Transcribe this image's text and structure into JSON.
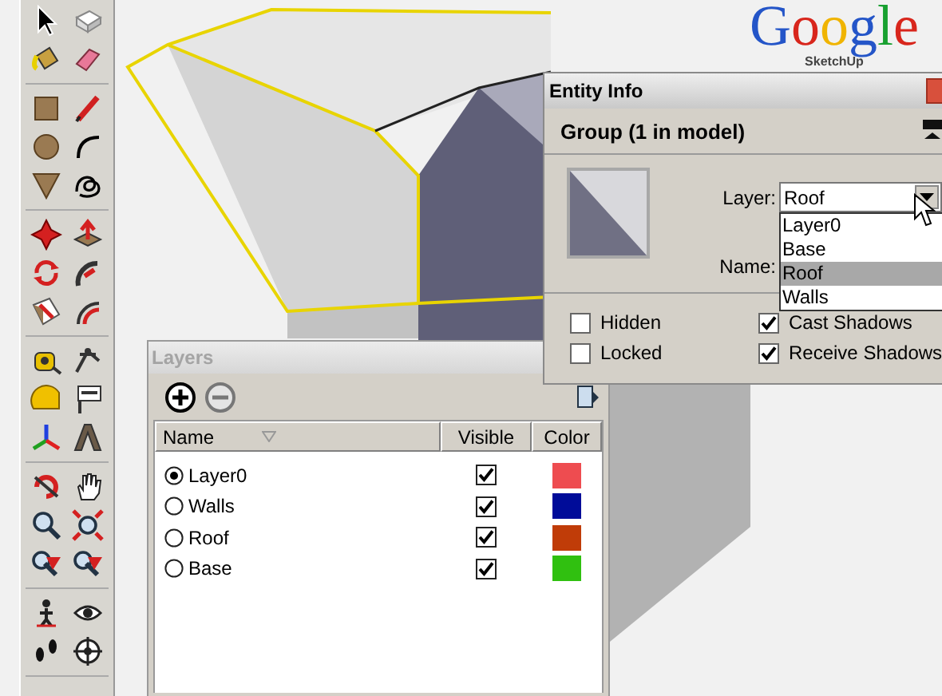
{
  "logo": {
    "title": "Google",
    "subtitle": "SketchUp"
  },
  "entity_info": {
    "title": "Entity Info",
    "heading": "Group (1 in model)",
    "layer_label": "Layer:",
    "layer_value": "Roof",
    "name_label": "Name:",
    "layer_options": [
      {
        "label": "Layer0",
        "selected": false
      },
      {
        "label": "Base",
        "selected": false
      },
      {
        "label": "Roof",
        "selected": true
      },
      {
        "label": "Walls",
        "selected": false
      }
    ],
    "checkboxes": [
      {
        "label": "Hidden",
        "checked": false
      },
      {
        "label": "Cast Shadows",
        "checked": true
      },
      {
        "label": "Locked",
        "checked": false
      },
      {
        "label": "Receive Shadows",
        "checked": true
      }
    ]
  },
  "layers": {
    "title": "Layers",
    "columns": [
      "Name",
      "Visible",
      "Color"
    ],
    "rows": [
      {
        "name": "Layer0",
        "selected": true,
        "visible": true,
        "color": "#ee4c50"
      },
      {
        "name": "Walls",
        "selected": false,
        "visible": true,
        "color": "#000c99"
      },
      {
        "name": "Roof",
        "selected": false,
        "visible": true,
        "color": "#c03c08"
      },
      {
        "name": "Base",
        "selected": false,
        "visible": true,
        "color": "#30c010"
      }
    ]
  }
}
